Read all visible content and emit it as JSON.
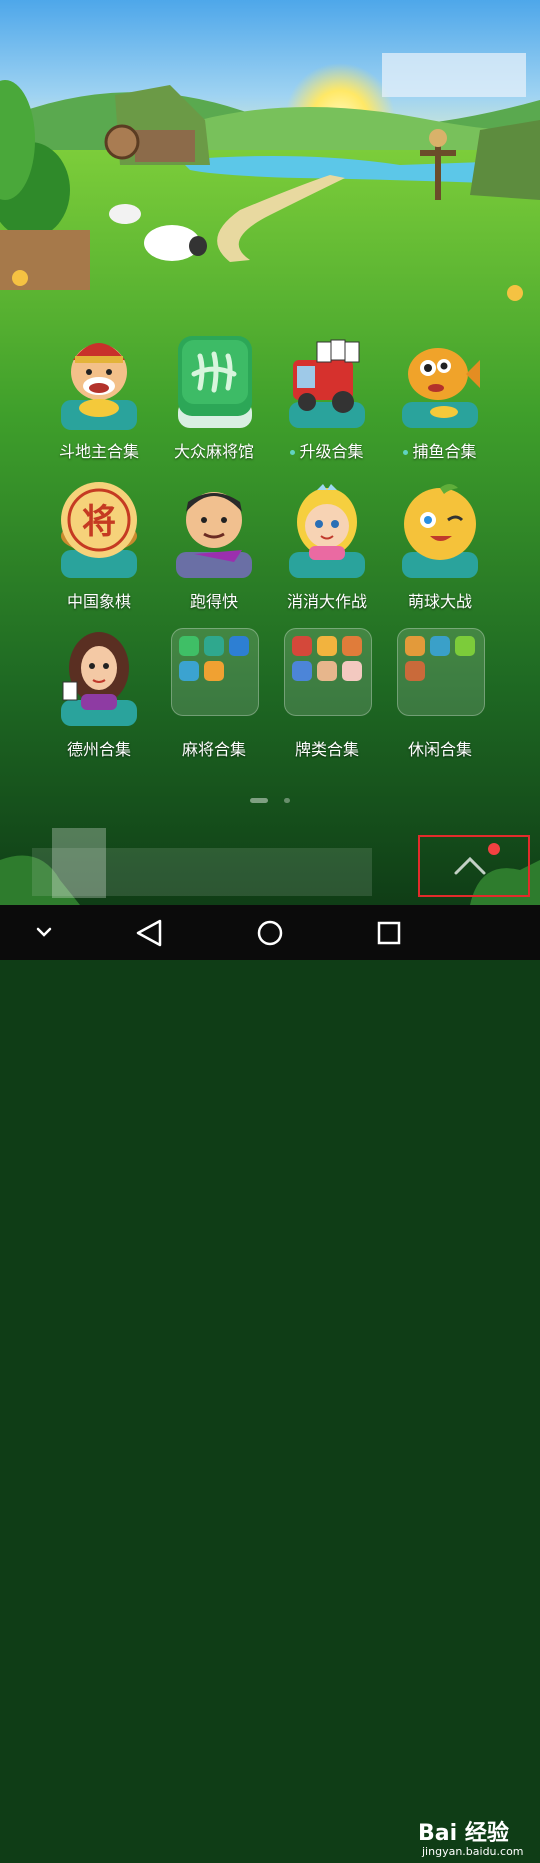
{
  "apps": [
    {
      "label": "斗地主合集",
      "icon": "landlord-character-icon"
    },
    {
      "label": "大众麻将馆",
      "icon": "mahjong-tile-icon"
    },
    {
      "label": "升级合集",
      "icon": "card-truck-icon",
      "has_update_dot": true
    },
    {
      "label": "捕鱼合集",
      "icon": "fish-icon",
      "has_update_dot": true
    },
    {
      "label": "中国象棋",
      "icon": "chess-piece-icon",
      "piece_text": "将"
    },
    {
      "label": "跑得快",
      "icon": "card-player-icon"
    },
    {
      "label": "消消大作战",
      "icon": "princess-icon"
    },
    {
      "label": "萌球大战",
      "icon": "winking-ball-icon"
    },
    {
      "label": "德州合集",
      "icon": "poker-lady-icon"
    },
    {
      "label": "麻将合集",
      "icon": "folder-icon"
    },
    {
      "label": "牌类合集",
      "icon": "folder-icon"
    },
    {
      "label": "休闲合集",
      "icon": "folder-icon"
    }
  ],
  "dots": {
    "update_dot_color": "#61d3c1"
  },
  "navbar": {
    "back": "back-icon",
    "home": "home-icon",
    "recents": "recents-icon",
    "hide": "chevron-down-icon"
  },
  "watermark": {
    "main": "Bai 经验",
    "sub": "jingyan.baidu.com"
  },
  "colors": {
    "highlight_box": "#e32b2b",
    "notification_dot": "#f24141"
  }
}
